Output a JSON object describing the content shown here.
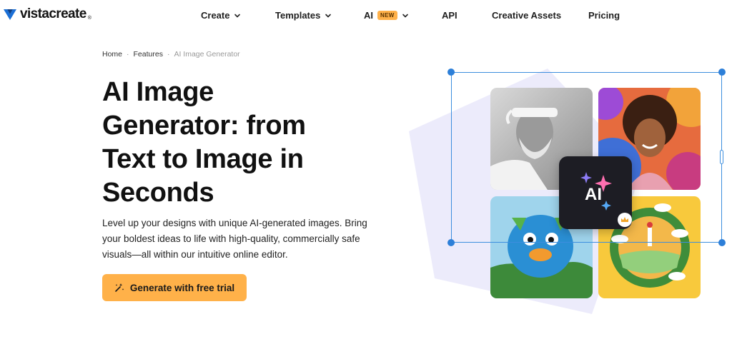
{
  "brand": {
    "name_part1": "vista",
    "name_part2": "create",
    "accent_color": "#1a6fd6"
  },
  "nav": {
    "items": [
      {
        "label": "Create",
        "has_dropdown": true
      },
      {
        "label": "Templates",
        "has_dropdown": true
      },
      {
        "label": "AI",
        "badge": "NEW",
        "has_dropdown": true
      },
      {
        "label": "API",
        "has_dropdown": false
      },
      {
        "label": "Creative Assets",
        "has_dropdown": false
      },
      {
        "label": "Pricing",
        "has_dropdown": false
      }
    ]
  },
  "breadcrumb": {
    "items": [
      "Home",
      "Features",
      "AI Image Generator"
    ],
    "separator": "·"
  },
  "hero": {
    "title_lines": [
      "AI Image",
      "Generator: from",
      "Text to Image in",
      "Seconds"
    ],
    "description_lines": [
      "Level up your designs with unique AI-generated images. Bring",
      "your boldest ideas to life with high-quality, commercially safe",
      "visuals—all within our intuitive online editor."
    ],
    "cta_label": "Generate with free trial",
    "cta_color": "#ffb149"
  },
  "illustration": {
    "ai_card_label": "AI",
    "selection_color": "#3c8ede",
    "tiles": [
      "portrait-old-man-image",
      "portrait-woman-image",
      "plush-bird-image",
      "wreath-scene-image"
    ]
  }
}
